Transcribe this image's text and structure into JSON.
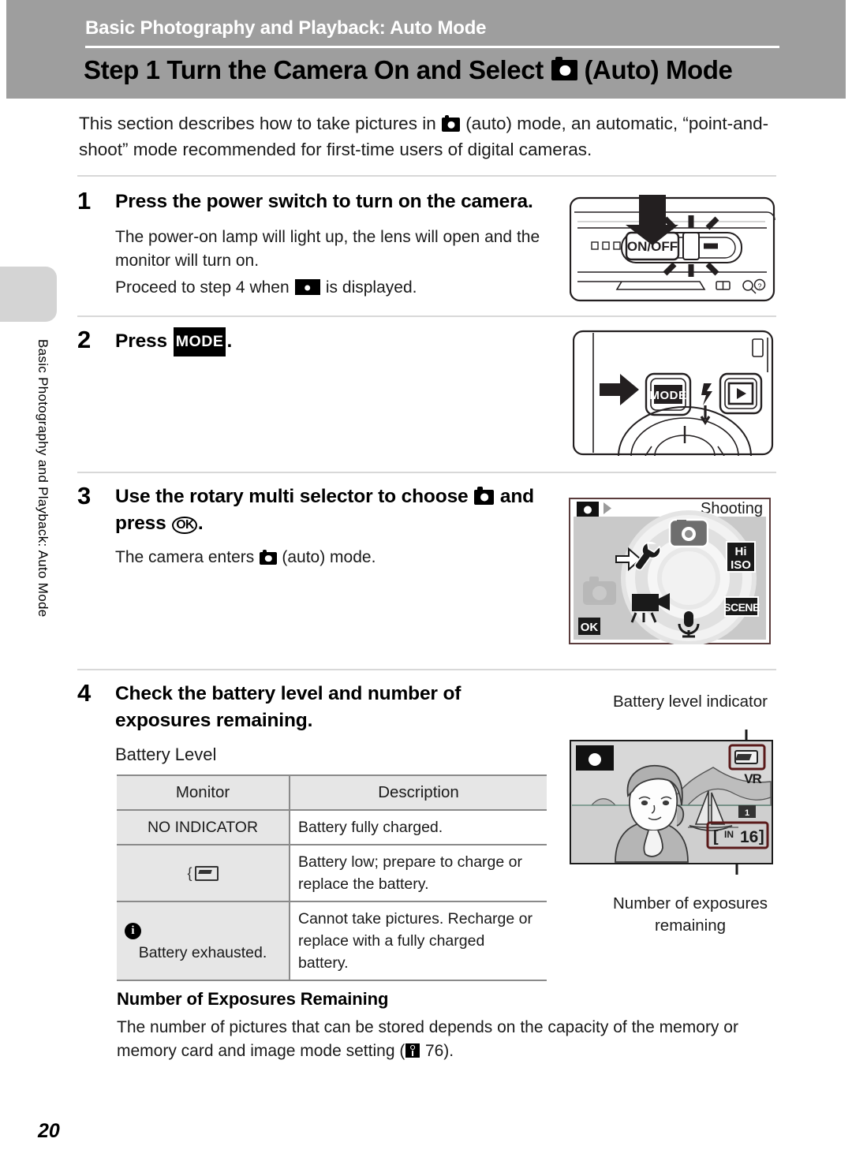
{
  "header": {
    "chapter": "Basic Photography and Playback: Auto Mode",
    "step_title_pre": "Step 1 Turn the Camera On and Select",
    "step_title_post": "(Auto) Mode"
  },
  "sidebar": {
    "vertical_label": "Basic Photography and Playback: Auto Mode"
  },
  "intro": {
    "line1_pre": "This section describes how to take pictures in",
    "line1_post": "(auto) mode, an automatic,",
    "line2": "“point-and-shoot” mode recommended for first-time users of digital cameras."
  },
  "steps": [
    {
      "num": "1",
      "heading": "Press the power switch to turn on the camera.",
      "body1": "The power-on lamp will light up, the lens will open and the monitor will turn on.",
      "body2_pre": "Proceed to step 4 when",
      "body2_post": "is displayed."
    },
    {
      "num": "2",
      "heading_pre": "Press",
      "heading_icon": "MODE",
      "heading_post": "."
    },
    {
      "num": "3",
      "heading_pre": "Use the rotary multi selector to choose",
      "heading_mid": "and press",
      "heading_ok": "OK",
      "heading_post": ".",
      "body_pre": "The camera enters",
      "body_post": "(auto) mode."
    },
    {
      "num": "4",
      "heading": "Check the battery level and number of exposures remaining.",
      "subhead": "Battery Level"
    }
  ],
  "battery_table": {
    "columns": [
      "Monitor",
      "Description"
    ],
    "rows": [
      {
        "monitor": "NO INDICATOR",
        "monitor_icon": "none",
        "description": "Battery fully charged."
      },
      {
        "monitor": "",
        "monitor_icon": "battery-low-icon",
        "description": "Battery low; prepare to charge or replace the battery."
      },
      {
        "monitor": "Battery exhausted.",
        "monitor_icon": "info-icon",
        "description": "Cannot take pictures. Recharge or replace with a fully charged battery."
      }
    ]
  },
  "exposures_section": {
    "heading": "Number of Exposures Remaining",
    "body_pre": "The number of pictures that can be stored depends on the capacity of the memory or memory card and image mode setting (",
    "body_ref": "76",
    "body_post": ")."
  },
  "illustrations": {
    "power_switch": {
      "label": "ON/OFF"
    },
    "mode_button": {
      "label": "MODE"
    },
    "shooting_menu": {
      "title": "Shooting",
      "ok_label": "OK",
      "items": [
        "auto-camera-icon",
        "hi-iso-icon",
        "scene-icon",
        "microphone-icon",
        "movie-icon",
        "setup-wrench-icon"
      ],
      "hi_iso_top": "Hi",
      "hi_iso_bottom": "ISO",
      "scene_label": "SCENE"
    },
    "monitor_view": {
      "caption_top": "Battery level indicator",
      "caption_bottom": "Number of exposures remaining",
      "vr_label": "VR",
      "exposures_value": "16",
      "exposures_prefix": "IN"
    }
  },
  "page_number": "20"
}
